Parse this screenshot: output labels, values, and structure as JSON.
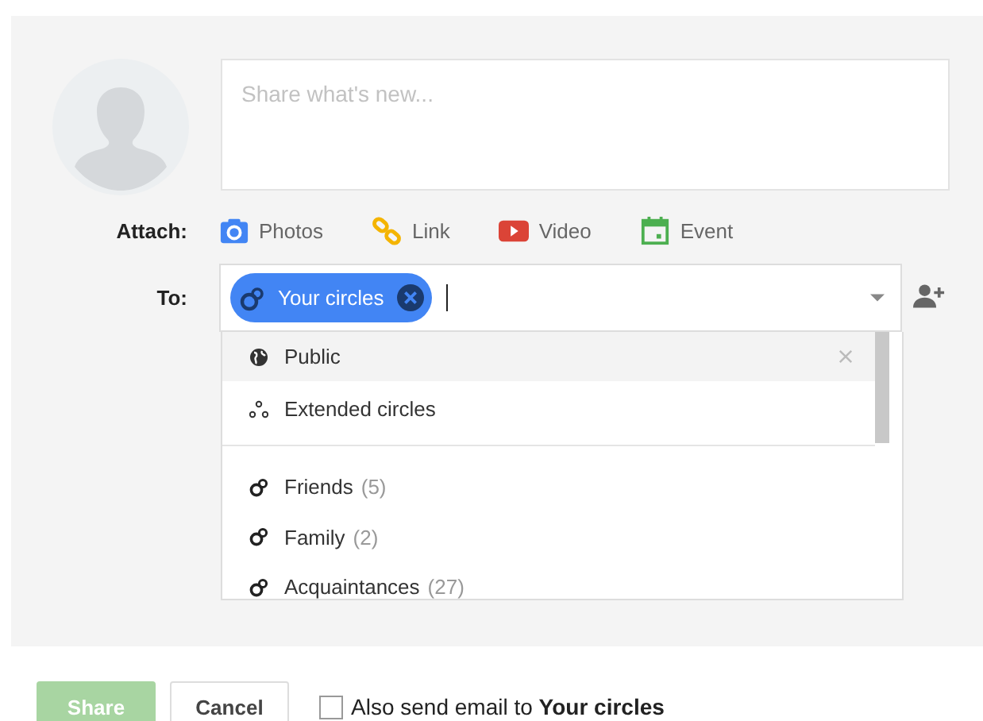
{
  "composer": {
    "placeholder": "Share what's new..."
  },
  "attach": {
    "label": "Attach:",
    "options": [
      {
        "kind": "photos",
        "label": "Photos"
      },
      {
        "kind": "link",
        "label": "Link"
      },
      {
        "kind": "video",
        "label": "Video"
      },
      {
        "kind": "event",
        "label": "Event"
      }
    ]
  },
  "to": {
    "label": "To:",
    "chips": [
      {
        "label": "Your circles"
      }
    ]
  },
  "dropdown": {
    "items": [
      {
        "kind": "public",
        "label": "Public",
        "selected": true
      },
      {
        "kind": "extended",
        "label": "Extended circles",
        "selected": false
      },
      {
        "kind": "divider"
      },
      {
        "kind": "circle",
        "label": "Friends",
        "count": "(5)",
        "selected": false
      },
      {
        "kind": "circle",
        "label": "Family",
        "count": "(2)",
        "selected": false
      },
      {
        "kind": "circle",
        "label": "Acquaintances",
        "count": "(27)",
        "selected": false
      }
    ]
  },
  "footer": {
    "share": {
      "label": "Share",
      "disabled": true
    },
    "cancel": "Cancel",
    "email": {
      "checked": false,
      "text": "Also send email to **Your circles**"
    }
  }
}
